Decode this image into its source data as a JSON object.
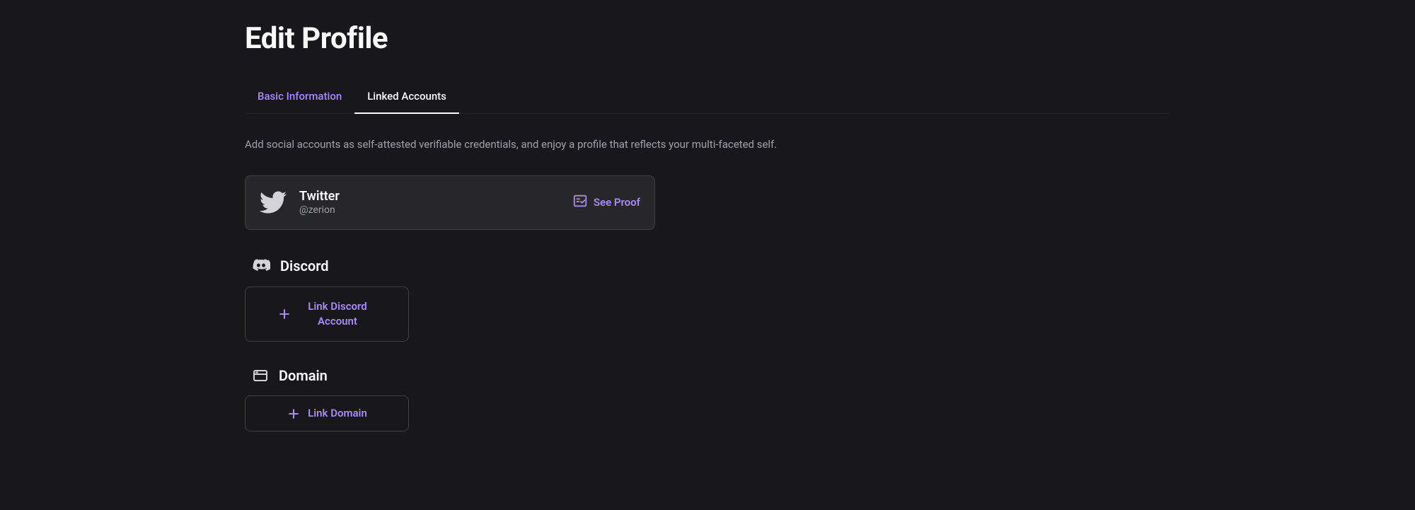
{
  "page": {
    "title": "Edit Profile",
    "description": "Add social accounts as self-attested verifiable credentials, and enjoy a profile that reflects your multi-faceted self."
  },
  "tabs": {
    "basic": "Basic Information",
    "linked": "Linked Accounts"
  },
  "twitter": {
    "title": "Twitter",
    "handle": "@zerion",
    "proof_label": "See Proof"
  },
  "discord": {
    "title": "Discord",
    "button_label": "Link Discord Account"
  },
  "domain": {
    "title": "Domain",
    "button_label": "Link Domain"
  },
  "colors": {
    "accent": "#a78bfa",
    "bg": "#18181b",
    "card_bg": "#27272a",
    "border": "#3f3f46",
    "text_muted": "#a1a1aa"
  }
}
